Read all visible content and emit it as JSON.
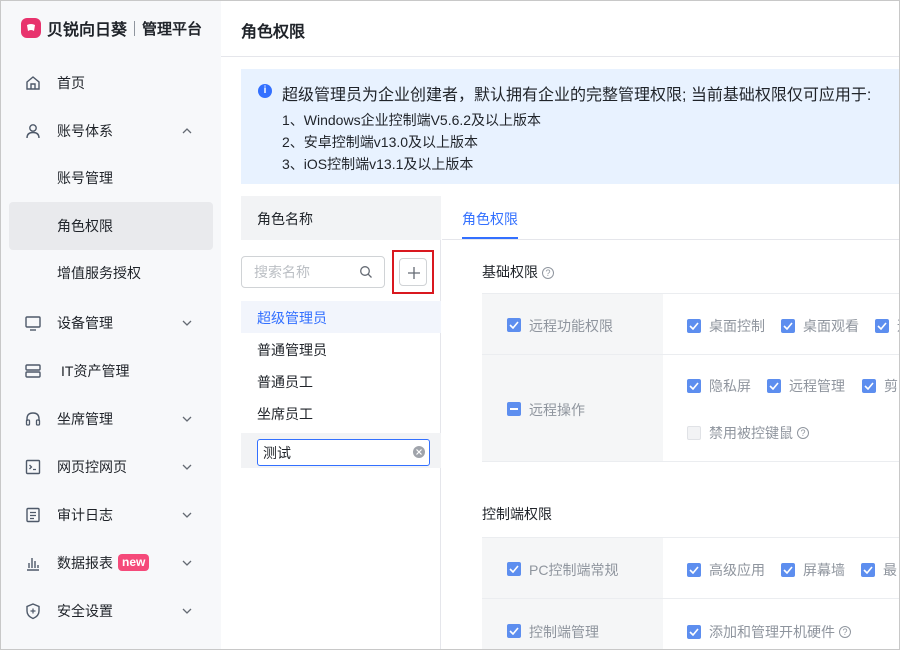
{
  "brand": {
    "name": "贝锐向日葵",
    "subtitle": "管理平台"
  },
  "sidebar": {
    "items": [
      {
        "label": "首页",
        "icon": "home-icon"
      },
      {
        "label": "账号体系",
        "icon": "user-icon",
        "expanded": true,
        "children": [
          {
            "label": "账号管理"
          },
          {
            "label": "角色权限",
            "active": true
          },
          {
            "label": "增值服务授权"
          }
        ]
      },
      {
        "label": "设备管理",
        "icon": "monitor-icon"
      },
      {
        "label": "IT资产管理",
        "icon": "server-icon"
      },
      {
        "label": "坐席管理",
        "icon": "headset-icon"
      },
      {
        "label": "网页控网页",
        "icon": "web-terminal-icon"
      },
      {
        "label": "审计日志",
        "icon": "log-icon"
      },
      {
        "label": "数据报表",
        "icon": "bar-chart-icon",
        "badge": "new"
      },
      {
        "label": "安全设置",
        "icon": "shield-icon"
      }
    ]
  },
  "page": {
    "title": "角色权限"
  },
  "notice": {
    "main": "超级管理员为企业创建者，默认拥有企业的完整管理权限; 当前基础权限仅可应用于:",
    "lines": [
      "1、Windows企业控制端V5.6.2及以上版本",
      "2、安卓控制端v13.0及以上版本",
      "3、iOS控制端v13.1及以上版本"
    ]
  },
  "roles": {
    "header": "角色名称",
    "search_placeholder": "搜索名称",
    "items": [
      "超级管理员",
      "普通管理员",
      "普通员工",
      "坐席员工"
    ],
    "selected": "超级管理员",
    "editing_value": "测试"
  },
  "permissions": {
    "tab": "角色权限",
    "basic": {
      "title": "基础权限",
      "rows": [
        {
          "category": "远程功能权限",
          "state": "checked",
          "options": [
            {
              "label": "桌面控制",
              "state": "checked"
            },
            {
              "label": "桌面观看",
              "state": "checked"
            },
            {
              "label": "远",
              "state": "checked"
            }
          ]
        },
        {
          "category": "远程操作",
          "state": "partial",
          "options": [
            {
              "label": "隐私屏",
              "state": "checked"
            },
            {
              "label": "远程管理",
              "state": "checked"
            },
            {
              "label": "剪",
              "state": "checked"
            },
            {
              "label": "禁用被控键鼠",
              "state": "unchecked"
            }
          ]
        }
      ]
    },
    "console": {
      "title": "控制端权限",
      "rows": [
        {
          "category": "PC控制端常规",
          "state": "checked",
          "options": [
            {
              "label": "高级应用",
              "state": "checked"
            },
            {
              "label": "屏幕墙",
              "state": "checked"
            },
            {
              "label": "最",
              "state": "checked"
            }
          ]
        },
        {
          "category": "控制端管理",
          "state": "checked",
          "options": [
            {
              "label": "添加和管理开机硬件",
              "state": "checked"
            }
          ]
        }
      ]
    }
  },
  "colors": {
    "accent": "#3370ff",
    "brand": "#e8336d",
    "badge": "#f54a7a",
    "highlight_border": "#d9181f"
  }
}
